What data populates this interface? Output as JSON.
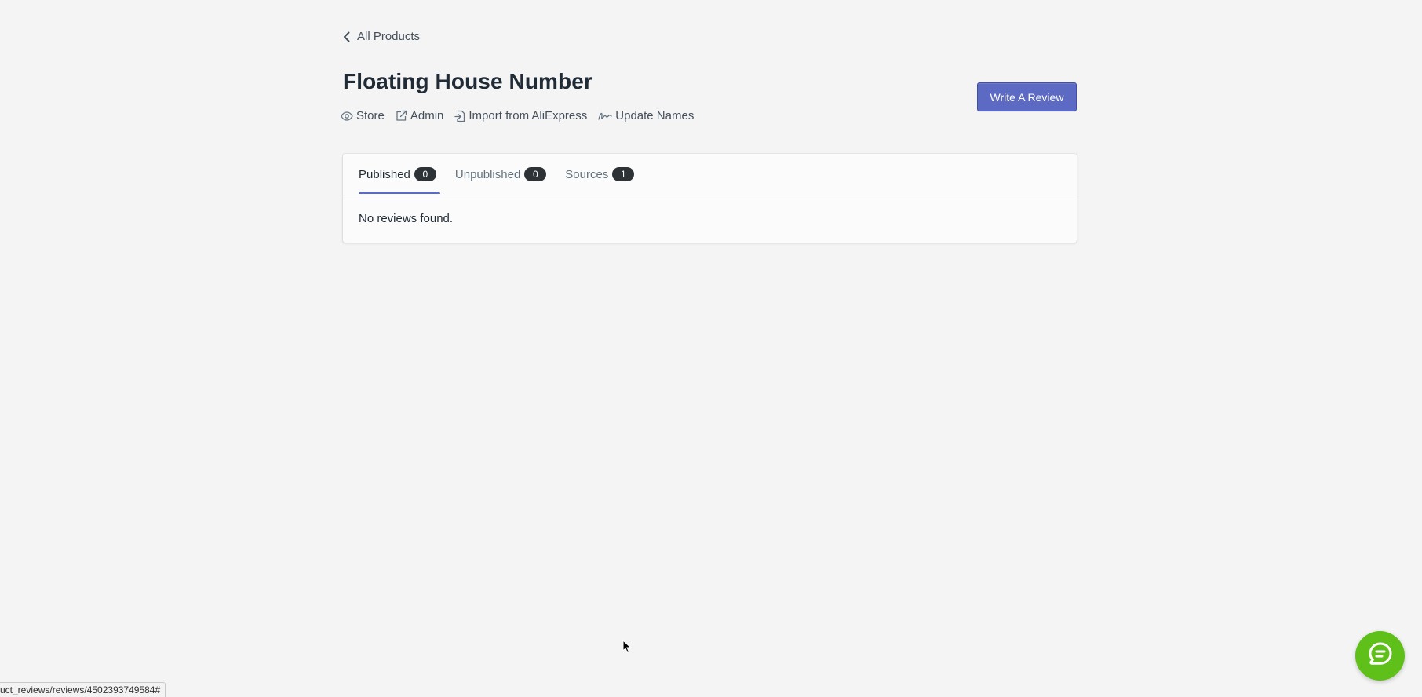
{
  "nav": {
    "back_label": "All Products"
  },
  "product": {
    "title": "Floating House Number"
  },
  "actions": [
    {
      "label": "Store",
      "icon": "eye-icon"
    },
    {
      "label": "Admin",
      "icon": "external-link-icon"
    },
    {
      "label": "Import from AliExpress",
      "icon": "import-file-icon"
    },
    {
      "label": "Update Names",
      "icon": "signature-icon"
    }
  ],
  "primary_button": {
    "label": "Write A Review"
  },
  "tabs": [
    {
      "label": "Published",
      "count": "0",
      "active": true
    },
    {
      "label": "Unpublished",
      "count": "0",
      "active": false
    },
    {
      "label": "Sources",
      "count": "1",
      "active": false
    }
  ],
  "reviews": {
    "empty_message": "No reviews found."
  },
  "status_bar": {
    "url": "uct_reviews/reviews/4502393749584#"
  },
  "chat": {
    "icon": "chat-bubble-icon"
  },
  "colors": {
    "accent": "#5c6ac4",
    "chat": "#5fc01a",
    "badge": "#2c3236",
    "background": "#f4f4f4"
  }
}
